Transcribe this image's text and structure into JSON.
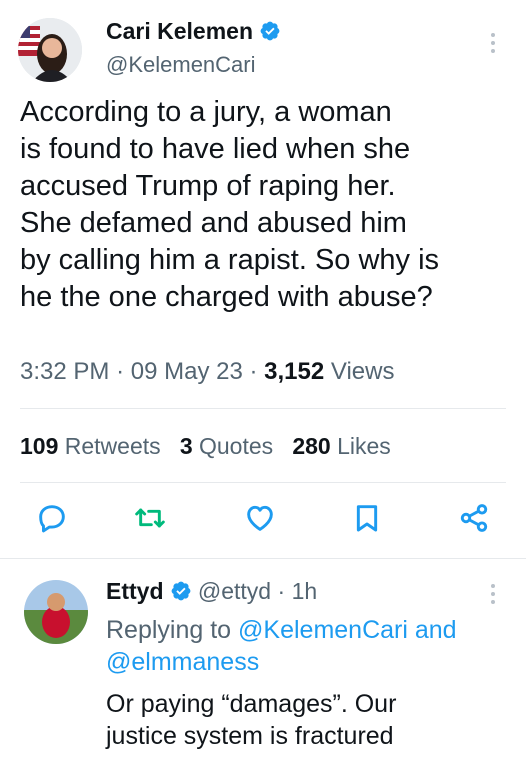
{
  "tweet": {
    "author_name": "Cari Kelemen",
    "author_handle": "@KelemenCari",
    "text_lines": [
      "According to a jury, a woman",
      "is found to have lied when she",
      "accused Trump of raping her.",
      "She defamed and abused him",
      "by calling him a rapist. So why is",
      "he the one charged with abuse?"
    ],
    "time": "3:32 PM",
    "date": "09 May 23",
    "views_count": "3,152",
    "views_label": "Views",
    "sep": "·"
  },
  "stats": {
    "retweets_count": "109",
    "retweets_label": "Retweets",
    "quotes_count": "3",
    "quotes_label": "Quotes",
    "likes_count": "280",
    "likes_label": "Likes"
  },
  "actions": [
    "reply-icon",
    "retweet-icon",
    "like-icon",
    "bookmark-icon",
    "share-icon"
  ],
  "reply": {
    "author_name": "Ettyd",
    "author_handle": "@ettyd",
    "age": "1h",
    "sep": "·",
    "replying_prefix": "Replying to",
    "replying_to_1": "@KelemenCari",
    "replying_and": "and",
    "replying_to_2": "@elmmaness",
    "text_lines": [
      "Or paying “damages”.  Our",
      "justice system is fractured"
    ]
  },
  "colors": {
    "accent": "#1d9bf0",
    "retweet": "#00ba7c",
    "text": "#0f1419",
    "muted": "#536471",
    "verified": "#1d9bf0"
  }
}
